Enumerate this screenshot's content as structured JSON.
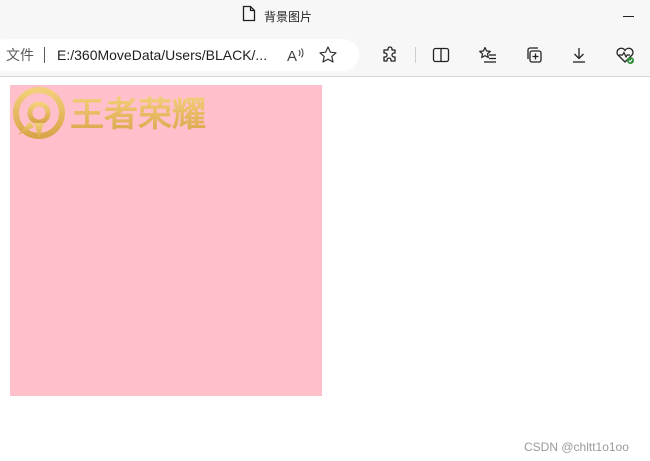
{
  "window": {
    "title": "背景图片",
    "minimize_label": "Minimize"
  },
  "toolbar": {
    "scheme_label": "文件",
    "url": "E:/360MoveData/Users/BLACK/..."
  },
  "page": {
    "background_box_color": "#ffc0cb",
    "logo_text": "王者荣耀",
    "logo_color": "#e6b85c"
  },
  "watermark": "CSDN @chltt1o1oo",
  "icons": [
    "page-icon",
    "read-aloud-icon",
    "favorite-star-icon",
    "extensions-icon",
    "split-screen-icon",
    "favorites-list-icon",
    "collections-icon",
    "download-icon",
    "browser-essentials-icon"
  ]
}
